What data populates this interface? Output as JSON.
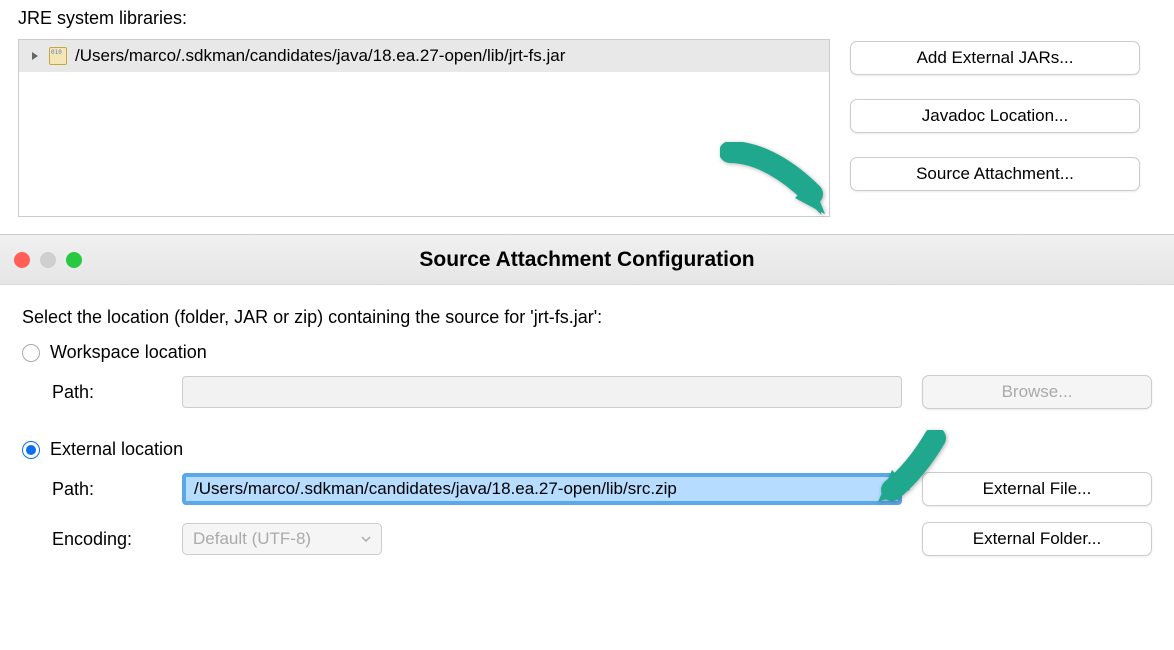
{
  "jre": {
    "label": "JRE system libraries:",
    "tree_item": "/Users/marco/.sdkman/candidates/java/18.ea.27-open/lib/jrt-fs.jar",
    "buttons": {
      "add_external": "Add External JARs...",
      "javadoc": "Javadoc Location...",
      "source_attach": "Source Attachment..."
    }
  },
  "dialog": {
    "title": "Source Attachment Configuration",
    "instruction": "Select the location (folder, JAR or zip) containing the source for 'jrt-fs.jar':",
    "workspace": {
      "label": "Workspace location",
      "path_label": "Path:",
      "browse": "Browse..."
    },
    "external": {
      "label": "External location",
      "path_label": "Path:",
      "path_value": "/Users/marco/.sdkman/candidates/java/18.ea.27-open/lib/src.zip",
      "encoding_label": "Encoding:",
      "encoding_value": "Default (UTF-8)",
      "external_file": "External File...",
      "external_folder": "External Folder..."
    }
  },
  "annotations": {
    "arrow_color": "#1fa88e"
  }
}
